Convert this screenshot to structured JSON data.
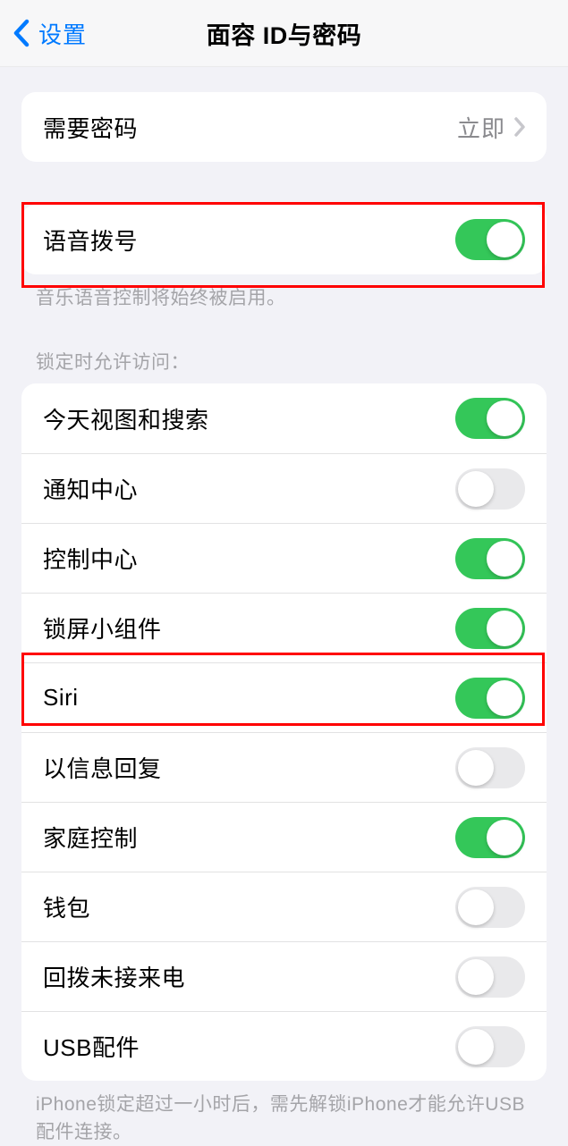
{
  "nav": {
    "back_label": "设置",
    "title": "面容 ID与密码"
  },
  "passcode_row": {
    "label": "需要密码",
    "value": "立即"
  },
  "voice_dial": {
    "label": "语音拨号",
    "on": true,
    "footer": "音乐语音控制将始终被启用。"
  },
  "lockscreen": {
    "header": "锁定时允许访问：",
    "items": [
      {
        "label": "今天视图和搜索",
        "on": true
      },
      {
        "label": "通知中心",
        "on": false
      },
      {
        "label": "控制中心",
        "on": true
      },
      {
        "label": "锁屏小组件",
        "on": true
      },
      {
        "label": "Siri",
        "on": true
      },
      {
        "label": "以信息回复",
        "on": false
      },
      {
        "label": "家庭控制",
        "on": true
      },
      {
        "label": "钱包",
        "on": false
      },
      {
        "label": "回拨未接来电",
        "on": false
      },
      {
        "label": "USB配件",
        "on": false
      }
    ],
    "footer": "iPhone锁定超过一小时后，需先解锁iPhone才能允许USB配件连接。"
  }
}
